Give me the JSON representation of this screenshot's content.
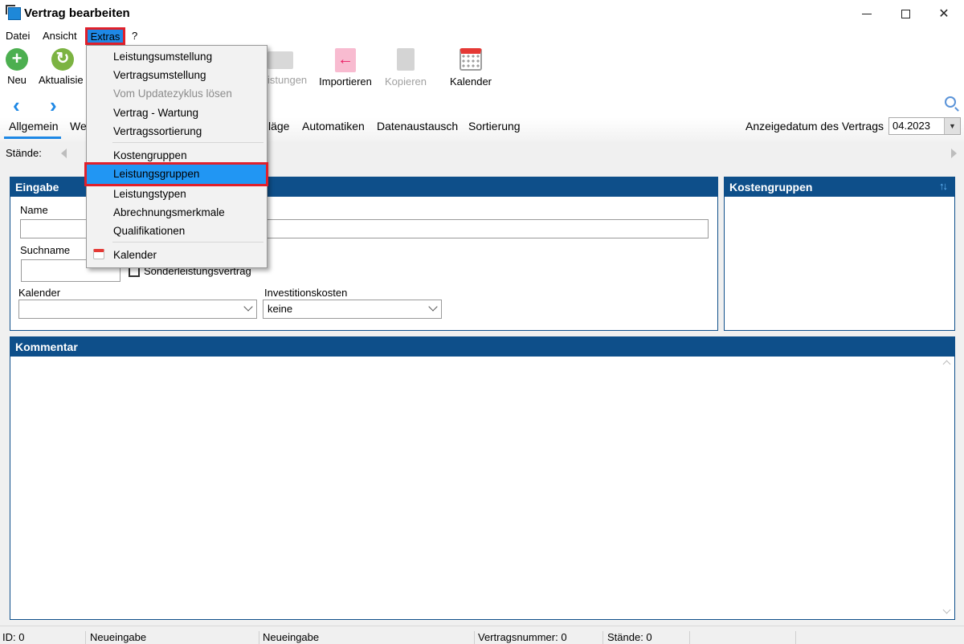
{
  "window": {
    "title": "Vertrag bearbeiten"
  },
  "menubar": {
    "items": [
      "Datei",
      "Ansicht",
      "Extras",
      "?"
    ]
  },
  "toolbar": {
    "neu": "Neu",
    "aktualisieren": "Aktualisie",
    "leistungen": "istungen",
    "importieren": "Importieren",
    "kopieren": "Kopieren",
    "kalender": "Kalender"
  },
  "tabs": [
    "Allgemein",
    "We",
    "läge",
    "Automatiken",
    "Datenaustausch",
    "Sortierung"
  ],
  "anzeigedatum": {
    "label": "Anzeigedatum des Vertrags",
    "value": "04.2023"
  },
  "staende_label": "Stände:",
  "eingabe": {
    "header": "Eingabe",
    "name_label": "Name",
    "suchname_label": "Suchname",
    "sonderleistung_label": "Sonderleistungsvertrag",
    "kalender_label": "Kalender",
    "kalender_value": "",
    "investitionskosten_label": "Investitionskosten",
    "investitionskosten_value": "keine"
  },
  "kostengruppen_panel": {
    "header": "Kostengruppen",
    "sort_icon_text": "↑↓"
  },
  "kommentar": {
    "header": "Kommentar"
  },
  "extras_menu": {
    "items": [
      {
        "label": "Leistungsumstellung",
        "enabled": true
      },
      {
        "label": "Vertragsumstellung",
        "enabled": true
      },
      {
        "label": "Vom Updatezyklus lösen",
        "enabled": false
      },
      {
        "label": "Vertrag - Wartung",
        "enabled": true
      },
      {
        "label": "Vertragssortierung",
        "enabled": true
      },
      {
        "label": "Kostengruppen",
        "enabled": true
      },
      {
        "label": "Leistungsgruppen",
        "enabled": true,
        "highlighted": true
      },
      {
        "label": "Leistungstypen",
        "enabled": true
      },
      {
        "label": "Abrechnungsmerkmale",
        "enabled": true
      },
      {
        "label": "Qualifikationen",
        "enabled": true
      },
      {
        "label": "Kalender",
        "enabled": true
      }
    ]
  },
  "statusbar": {
    "id": "ID: 0",
    "status1": "Neueingabe",
    "status2": "Neueingabe",
    "vertragsnummer": "Vertragsnummer: 0",
    "staende": "Stände: 0"
  },
  "colors": {
    "accent": "#1e88e5",
    "panel_header": "#0e4f8a",
    "highlight_border": "#e0202b"
  }
}
